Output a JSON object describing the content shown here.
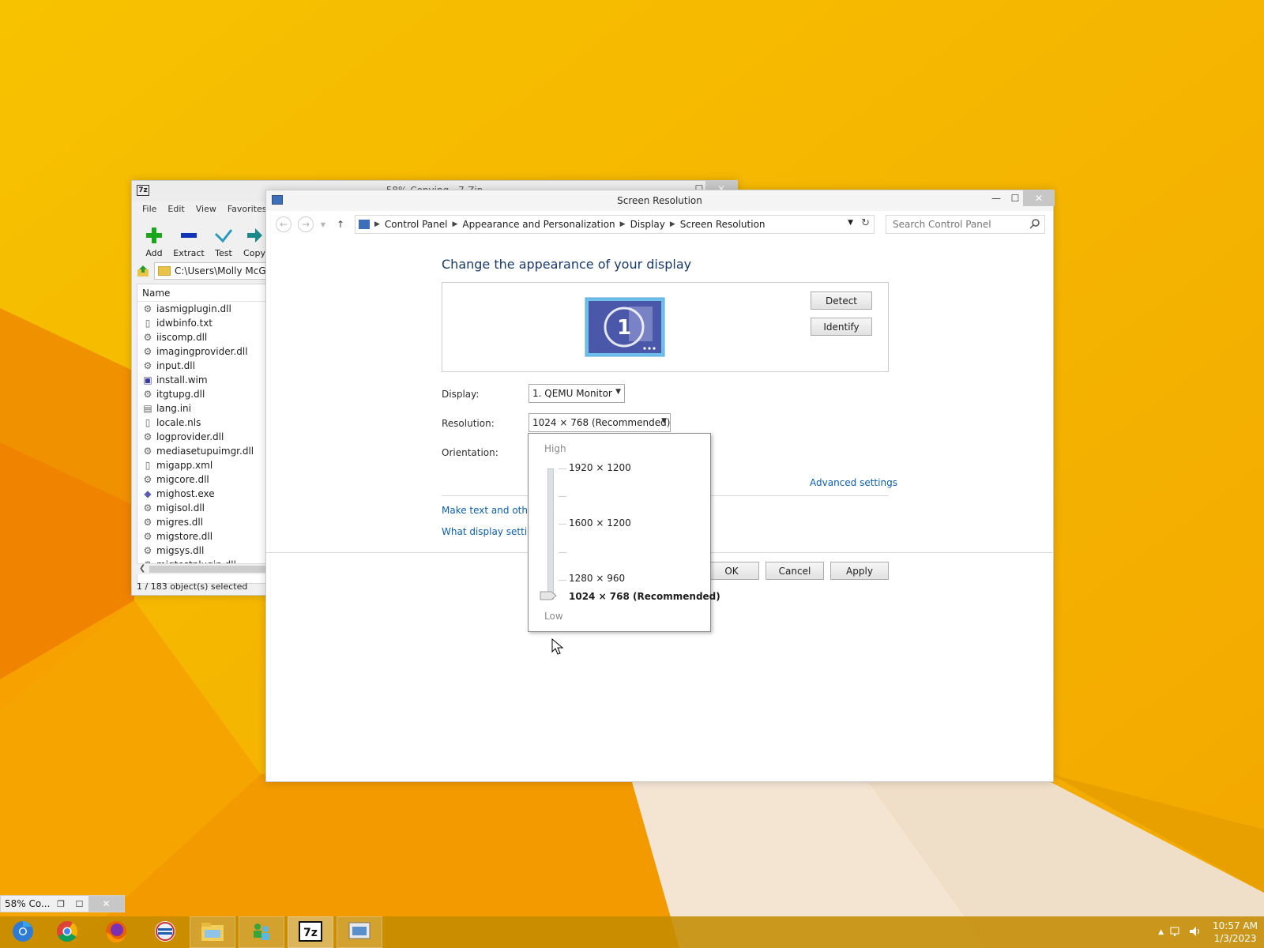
{
  "zip_window": {
    "title": "58% Copying - 7-Zip",
    "menu": [
      "File",
      "Edit",
      "View",
      "Favorites"
    ],
    "toolbar": [
      "Add",
      "Extract",
      "Test",
      "Copy"
    ],
    "path": "C:\\Users\\Molly McG",
    "column_name": "Name",
    "files": [
      {
        "name": "iasmigplugin.dll",
        "icon": "gear-icon"
      },
      {
        "name": "idwbinfo.txt",
        "icon": "document-icon"
      },
      {
        "name": "iiscomp.dll",
        "icon": "gear-icon"
      },
      {
        "name": "imagingprovider.dll",
        "icon": "gear-icon"
      },
      {
        "name": "input.dll",
        "icon": "gear-icon"
      },
      {
        "name": "install.wim",
        "icon": "wim-icon"
      },
      {
        "name": "itgtupg.dll",
        "icon": "gear-icon"
      },
      {
        "name": "lang.ini",
        "icon": "ini-icon"
      },
      {
        "name": "locale.nls",
        "icon": "document-icon"
      },
      {
        "name": "logprovider.dll",
        "icon": "gear-icon"
      },
      {
        "name": "mediasetupuimgr.dll",
        "icon": "gear-icon"
      },
      {
        "name": "migapp.xml",
        "icon": "document-icon"
      },
      {
        "name": "migcore.dll",
        "icon": "gear-icon"
      },
      {
        "name": "mighost.exe",
        "icon": "exe-icon"
      },
      {
        "name": "migisol.dll",
        "icon": "gear-icon"
      },
      {
        "name": "migres.dll",
        "icon": "gear-icon"
      },
      {
        "name": "migstore.dll",
        "icon": "gear-icon"
      },
      {
        "name": "migsys.dll",
        "icon": "gear-icon"
      },
      {
        "name": "migtestplugin.dll",
        "icon": "gear-icon"
      }
    ],
    "status": "1 / 183 object(s) selected"
  },
  "sr_window": {
    "title": "Screen Resolution",
    "breadcrumb": [
      "Control Panel",
      "Appearance and Personalization",
      "Display",
      "Screen Resolution"
    ],
    "search_placeholder": "Search Control Panel",
    "heading": "Change the appearance of your display",
    "monitor_number": "1",
    "detect": "Detect",
    "identify": "Identify",
    "display_label": "Display:",
    "display_value": "1. QEMU Monitor",
    "resolution_label": "Resolution:",
    "resolution_value": "1024 × 768 (Recommended)",
    "orientation_label": "Orientation:",
    "advanced_link": "Advanced settings",
    "link1": "Make text and other",
    "link2": "What display settin",
    "ok": "OK",
    "cancel": "Cancel",
    "apply": "Apply"
  },
  "resolution_popup": {
    "high": "High",
    "low": "Low",
    "options": [
      "1920 × 1200",
      "1600 × 1200",
      "1280 × 960",
      "1024 × 768 (Recommended)"
    ],
    "selected": "1024 × 768 (Recommended)"
  },
  "minimized_progress": {
    "text": "58% Co..."
  },
  "taskbar": {
    "apps": [
      "chromium-icon",
      "chrome-icon",
      "firefox-icon",
      "opera-icon",
      "file-explorer-icon",
      "users-icon",
      "7zip-icon",
      "control-panel-icon"
    ],
    "active_index": 6,
    "time": "10:57 AM",
    "date": "1/3/2023"
  },
  "colors": {
    "wallpaper": "#f5b400",
    "taskbar": "#c48a00",
    "heading": "#17396e",
    "link": "#0a5fb0"
  }
}
